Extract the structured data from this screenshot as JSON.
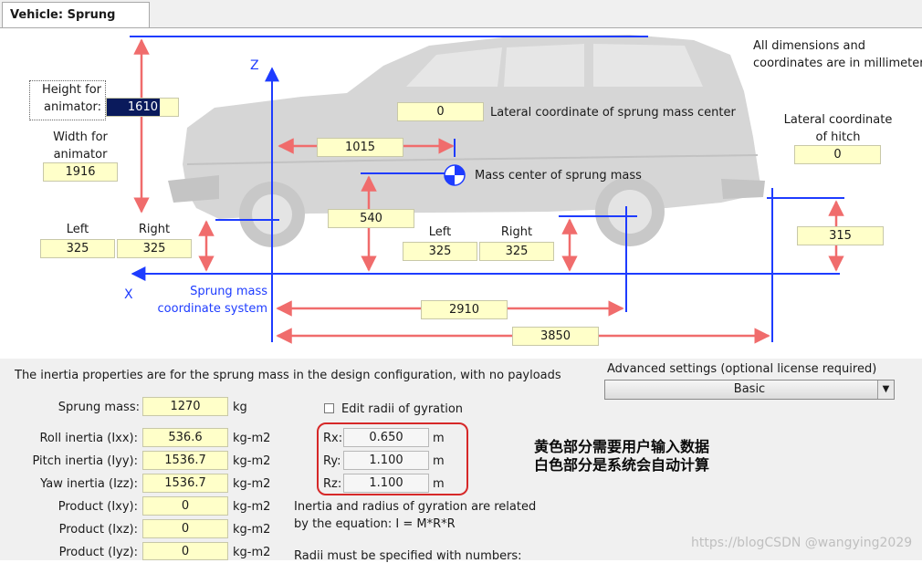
{
  "tab": {
    "label": "Vehicle: Sprung Mass"
  },
  "diagram": {
    "units_note_line1": "All dimensions and",
    "units_note_line2": "coordinates are in millimeters",
    "height_label_line1": "Height for",
    "height_label_line2": "animator:",
    "height_value": "1610",
    "width_label_line1": "Width for",
    "width_label_line2": "animator",
    "width_value": "1916",
    "lateral_cg_value": "0",
    "lateral_cg_label": "Lateral coordinate of sprung mass center",
    "hitch_label_line1": "Lateral coordinate",
    "hitch_label_line2": "of hitch",
    "hitch_value": "0",
    "cg_x_value": "1015",
    "mass_center_label": "Mass center of sprung mass",
    "cg_height_value": "540",
    "front_left_label": "Left",
    "front_right_label": "Right",
    "front_left_value": "325",
    "front_right_value": "325",
    "rear_left_label": "Left",
    "rear_right_label": "Right",
    "rear_left_value": "325",
    "rear_right_value": "325",
    "hitch_height_value": "315",
    "z_axis_label": "Z",
    "x_axis_label": "X",
    "coord_label_line1": "Sprung mass",
    "coord_label_line2": "coordinate system",
    "wheelbase_value": "2910",
    "hitch_x_value": "3850"
  },
  "inertia": {
    "description": "The inertia properties are for the sprung mass in the design configuration, with no payloads",
    "sprung_mass_label": "Sprung mass:",
    "sprung_mass_value": "1270",
    "sprung_mass_unit": "kg",
    "rows": [
      {
        "label": "Roll inertia (Ixx):",
        "value": "536.6",
        "unit": "kg-m2"
      },
      {
        "label": "Pitch inertia (Iyy):",
        "value": "1536.7",
        "unit": "kg-m2"
      },
      {
        "label": "Yaw inertia (Izz):",
        "value": "1536.7",
        "unit": "kg-m2"
      },
      {
        "label": "Product (Ixy):",
        "value": "0",
        "unit": "kg-m2"
      },
      {
        "label": "Product (Ixz):",
        "value": "0",
        "unit": "kg-m2"
      },
      {
        "label": "Product (Iyz):",
        "value": "0",
        "unit": "kg-m2"
      }
    ]
  },
  "gyration": {
    "checkbox_label": "Edit radii of gyration",
    "rows": [
      {
        "label": "Rx:",
        "value": "0.650",
        "unit": "m"
      },
      {
        "label": "Ry:",
        "value": "1.100",
        "unit": "m"
      },
      {
        "label": "Rz:",
        "value": "1.100",
        "unit": "m"
      }
    ],
    "equation_line1": "Inertia and radius of gyration are related",
    "equation_line2": "by the equation: I = M*R*R",
    "radii_note": "Radii must be specified with numbers:"
  },
  "advanced": {
    "label": "Advanced settings (optional license required)",
    "selected": "Basic"
  },
  "annotation": {
    "line1": "黄色部分需要用户输入数据",
    "line2": "白色部分是系统会自动计算"
  },
  "watermark": "https://blogCSDN @wangying2029",
  "colors": {
    "input_yellow": "#ffffc9",
    "axis_blue": "#1e3cff",
    "dimension_red": "#f06c6c",
    "highlight_red": "#d62828"
  }
}
